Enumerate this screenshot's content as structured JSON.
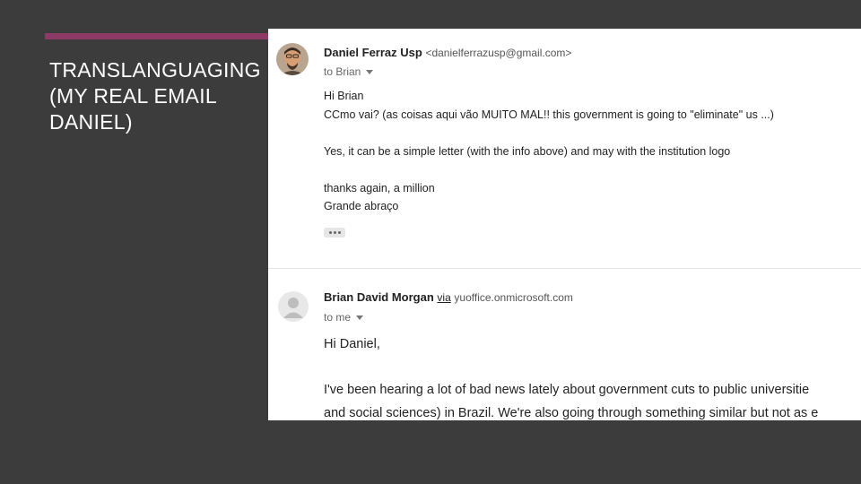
{
  "slide": {
    "title": "TRANSLANGUAGING\n(MY REAL EMAIL\nDANIEL)",
    "accent_color": "#8e3a66",
    "background_color": "#3c3c3c"
  },
  "email1": {
    "sender_name": "Daniel Ferraz Usp",
    "sender_email": "<danielferrazusp@gmail.com>",
    "to": "to Brian",
    "greeting": "Hi Brian",
    "line1": " CCmo vai? (as coisas aqui vão MUITO MAL!! this government is going to \"eliminate\" us ...)",
    "line2": "Yes, it can be a simple letter (with the info above) and may with the institution logo",
    "line3": "thanks again, a million",
    "line4": "Grande abraço",
    "avatar_icon": "person-photo-avatar",
    "more_icon": "ellipsis-icon"
  },
  "email2": {
    "sender_name": "Brian David Morgan",
    "via_label": "via",
    "via_domain": "yuoffice.onmicrosoft.com",
    "to": "to me",
    "greeting": "Hi Daniel,",
    "line1": "I've been hearing a lot of bad news lately about government cuts to public universitie",
    "line2": "and social sciences) in Brazil. We're also going through something similar but not as e",
    "avatar_icon": "generic-person-icon"
  }
}
